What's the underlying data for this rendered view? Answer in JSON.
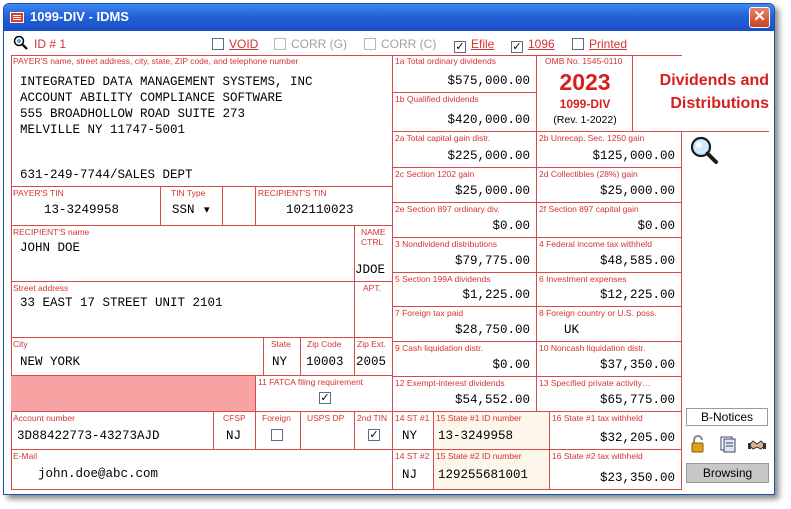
{
  "window": {
    "title": "1099-DIV - IDMS",
    "close_glyph": "✕"
  },
  "toolbar": {
    "id_label": "ID # 1",
    "void": {
      "label": "VOID",
      "checked": false
    },
    "corr_g": {
      "label": "CORR (G)",
      "checked": false
    },
    "corr_c": {
      "label": "CORR (C)",
      "checked": false
    },
    "efile": {
      "label": "Efile",
      "checked": true
    },
    "f1096": {
      "label": "1096",
      "checked": true
    },
    "printed": {
      "label": "Printed",
      "checked": false
    },
    "check_glyph": "✓"
  },
  "payer": {
    "label": "PAYER'S name, street address, city, state, ZIP code, and telephone number",
    "lines": [
      "INTEGRATED DATA MANAGEMENT SYSTEMS, INC",
      "ACCOUNT ABILITY COMPLIANCE SOFTWARE",
      "555 BROADHOLLOW ROAD SUITE 273",
      "MELVILLE NY 11747-5001"
    ],
    "phone": "631-249-7744/SALES DEPT",
    "tin_label": "PAYER'S TIN",
    "tin": "13-3249958",
    "tin_type_label": "TIN Type",
    "tin_type": "SSN",
    "dropdown_glyph": "▾"
  },
  "recipient": {
    "tin_label": "RECIPIENT'S TIN",
    "tin": "102110023",
    "name_label": "RECIPIENT'S name",
    "name": "JOHN DOE",
    "name_ctrl_label": "NAME CTRL",
    "name_ctrl": "JDOE",
    "street_label": "Street address",
    "street": "33 EAST 17 STREET UNIT 2101",
    "apt_label": "APT.",
    "city_label": "City",
    "city": "NEW YORK",
    "state_label": "State",
    "state": "NY",
    "zip_label": "Zip Code",
    "zip": "10003",
    "zip_ext_label": "Zip Ext.",
    "zip_ext": "2005",
    "fatca_label": "11 FATCA filing requirement",
    "fatca": true,
    "account_label": "Account number",
    "account": "3D88422773-43273AJD",
    "cfsp_label": "CFSP",
    "cfsp": "NJ",
    "foreign_label": "Foreign",
    "foreign": false,
    "usps_label": "USPS DP",
    "tin2_label": "2nd TIN",
    "tin2": true,
    "email_label": "E-Mail",
    "email": "john.doe@abc.com"
  },
  "omb": {
    "label": "OMB No. 1545-0110",
    "year": "2023",
    "form": "1099-DIV",
    "rev": "(Rev. 1-2022)"
  },
  "form_title": [
    "Dividends and",
    "Distributions"
  ],
  "boxes": {
    "b1a": {
      "label": "1a Total ordinary dividends",
      "value": "$575,000.00"
    },
    "b1b": {
      "label": "1b Qualified dividends",
      "value": "$420,000.00"
    },
    "b2a": {
      "label": "2a Total capital gain distr.",
      "value": "$225,000.00"
    },
    "b2b": {
      "label": "2b Unrecap. Sec. 1250 gain",
      "value": "$125,000.00"
    },
    "b2c": {
      "label": "2c Section 1202 gain",
      "value": "$25,000.00"
    },
    "b2d": {
      "label": "2d Collectibles (28%) gain",
      "value": "$25,000.00"
    },
    "b2e": {
      "label": "2e Section 897 ordinary div.",
      "value": "$0.00"
    },
    "b2f": {
      "label": "2f Section 897 capital gain",
      "value": "$0.00"
    },
    "b3": {
      "label": "3 Nondividend distributions",
      "value": "$79,775.00"
    },
    "b4": {
      "label": "4 Federal income tax withheld",
      "value": "$48,585.00"
    },
    "b5": {
      "label": "5 Section 199A dividends",
      "value": "$1,225.00"
    },
    "b6": {
      "label": "6 Investment expenses",
      "value": "$12,225.00"
    },
    "b7": {
      "label": "7 Foreign tax paid",
      "value": "$28,750.00"
    },
    "b8": {
      "label": "8 Foreign country or U.S. poss.",
      "value": "UK"
    },
    "b9": {
      "label": "9 Cash liquidation distr.",
      "value": "$0.00"
    },
    "b10": {
      "label": "10 Noncash liquidation distr.",
      "value": "$37,350.00"
    },
    "b12": {
      "label": "12 Exempt-interest dividends",
      "value": "$54,552.00"
    },
    "b13": {
      "label": "13 Specified private activity…",
      "value": "$65,775.00"
    }
  },
  "state_rows": [
    {
      "st_label": "14 ST #1",
      "st": "NY",
      "id_label": "15 State #1 ID number",
      "id": "13-3249958",
      "tax_label": "16 State #1 tax withheld",
      "tax": "$32,205.00"
    },
    {
      "st_label": "14 ST #2",
      "st": "NJ",
      "id_label": "15 State #2 ID number",
      "id": "129255681001",
      "tax_label": "16 State #2 tax withheld",
      "tax": "$23,350.00"
    }
  ],
  "side": {
    "b_notices": "B-Notices",
    "browsing": "Browsing"
  },
  "colors": {
    "accent_red": "#d63333",
    "grid": "#d64a4a",
    "title_blue": "#2462d8",
    "pink_cell": "#f7a3a3"
  }
}
